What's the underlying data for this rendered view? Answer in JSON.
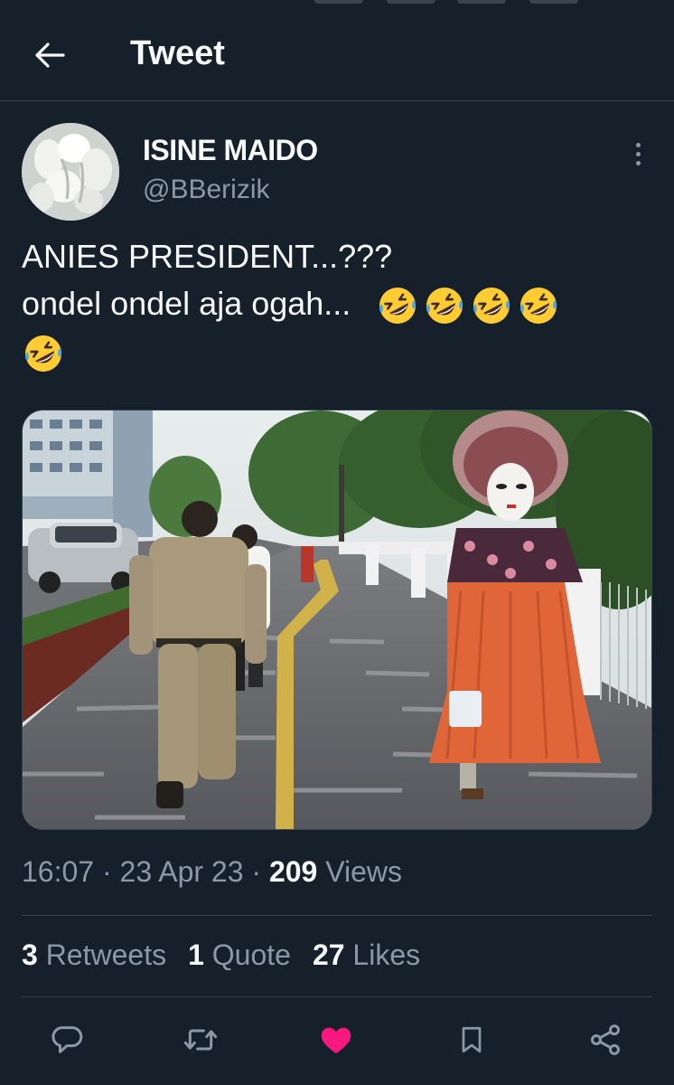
{
  "header": {
    "title": "Tweet",
    "back_icon": "arrow-left-icon"
  },
  "author": {
    "name": "ISINE MAIDO",
    "handle": "@BBerizik"
  },
  "tweet": {
    "line1": "ANIES PRESIDENT...???",
    "line2": "ondel ondel aja ogah...",
    "emoji": "rolling-on-floor-laughing-emoji",
    "emoji_count": 5
  },
  "meta": {
    "time": "16:07",
    "sep1": " · ",
    "date": "23 Apr 23",
    "sep2": " · ",
    "views_count": "209",
    "views_label": " Views"
  },
  "stats": {
    "retweets_count": "3",
    "retweets_label": " Retweets",
    "quotes_count": "1",
    "quotes_label": " Quote",
    "likes_count": "27",
    "likes_label": " Likes"
  },
  "actions": [
    "reply-icon",
    "retweet-icon",
    "heart-icon",
    "bookmark-icon",
    "share-icon"
  ],
  "colors": {
    "background": "#15202b",
    "text": "#f7f9f9",
    "secondary": "#8b98a5",
    "divider": "#38444d",
    "like": "#f91880"
  }
}
